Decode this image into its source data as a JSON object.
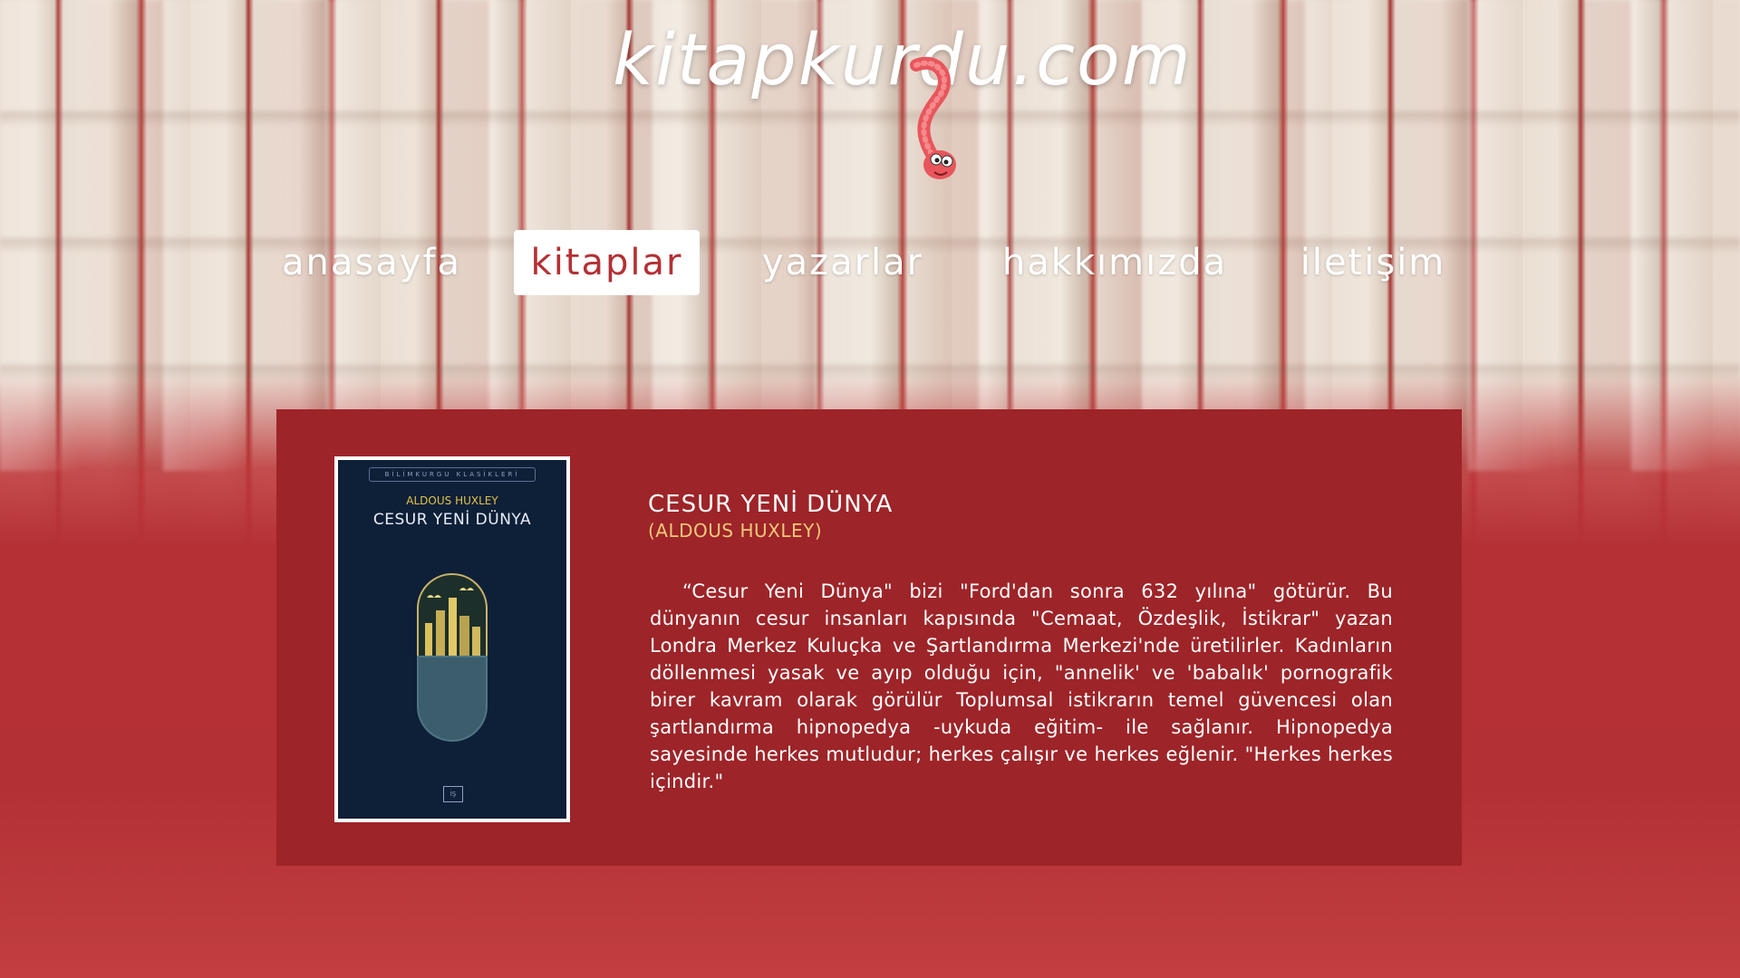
{
  "site": {
    "logo_text": "kitapkurdu.com"
  },
  "nav": {
    "items": [
      {
        "label": "anasayfa",
        "active": false
      },
      {
        "label": "kitaplar",
        "active": true
      },
      {
        "label": "yazarlar",
        "active": false
      },
      {
        "label": "hakkımızda",
        "active": false
      },
      {
        "label": "iletişim",
        "active": false
      }
    ]
  },
  "book": {
    "title": "CESUR YENİ DÜNYA",
    "author": "(ALDOUS HUXLEY)",
    "description": "“Cesur Yeni Dünya\" bizi \"Ford'dan sonra 632 yılına\" götürür. Bu dünyanın cesur insanları kapısında \"Cemaat, Özdeşlik, İstikrar\" yazan Londra Merkez Kuluçka ve Şartlandırma Merkezi'nde üretilirler. Kadınların döllenmesi yasak ve ayıp olduğu için, \"annelik' ve 'babalık' pornografik birer kavram olarak görülür Toplumsal istikrarın temel güvencesi olan şartlandırma hipnopedya -uykuda eğitim- ile sağlanır. Hipnopedya sayesinde herkes mutludur; herkes çalışır ve herkes eğlenir. \"Herkes herkes içindir.\"",
    "cover": {
      "series": "BİLİMKURGU KLASİKLERİ",
      "author": "ALDOUS HUXLEY",
      "title": "CESUR YENİ DÜNYA"
    }
  },
  "colors": {
    "panel": "#9d2428",
    "accent": "#b33034",
    "author_highlight": "#f0c87a"
  },
  "icons": {
    "mascot": "worm-icon"
  }
}
